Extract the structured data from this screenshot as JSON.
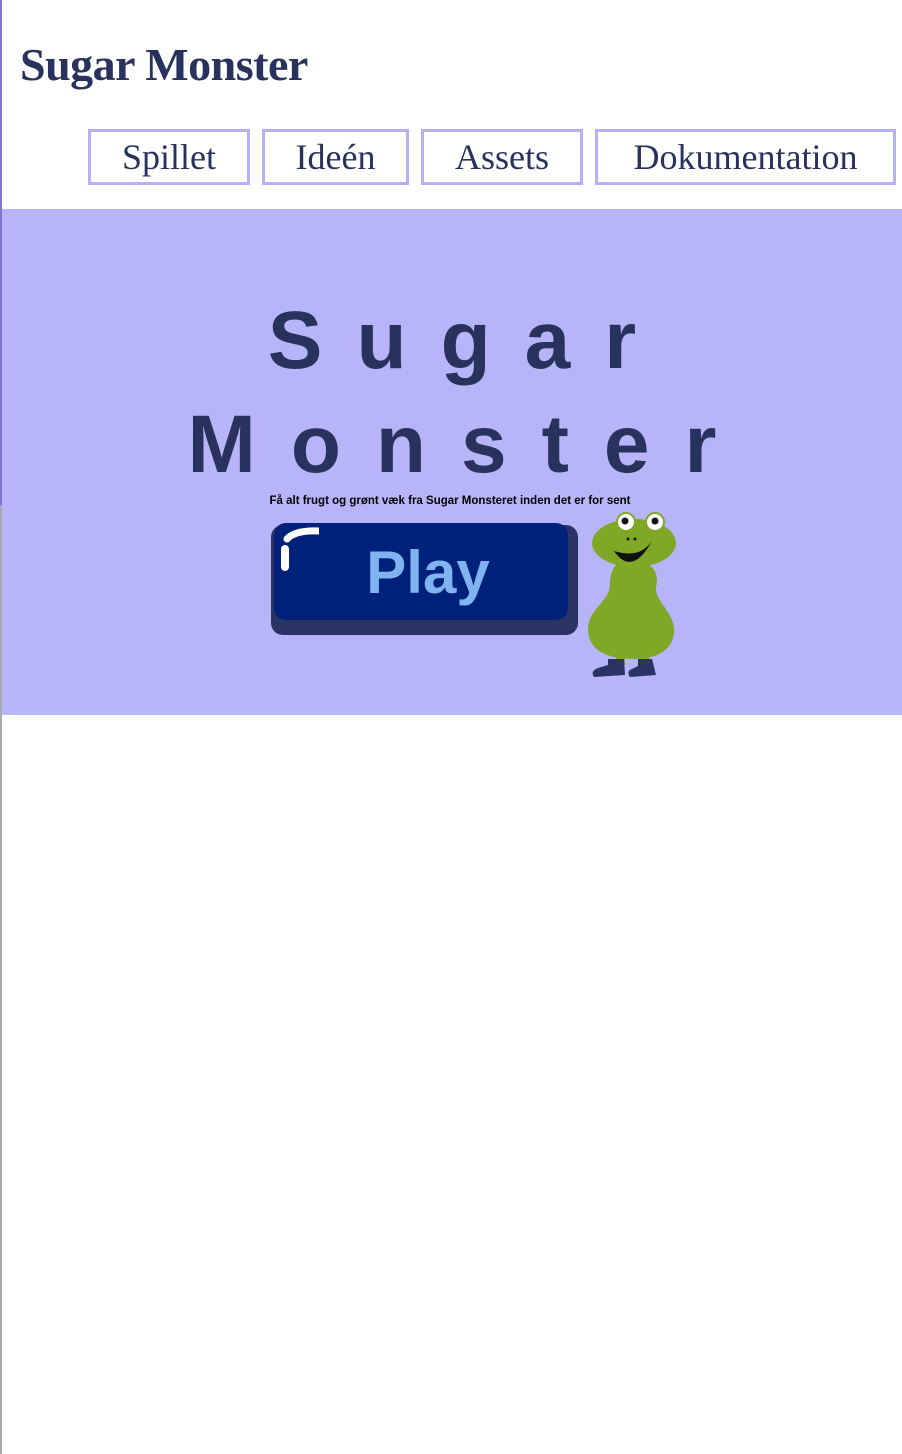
{
  "site": {
    "title": "Sugar Monster"
  },
  "nav": {
    "items": [
      {
        "label": "Spillet"
      },
      {
        "label": "Ideén"
      },
      {
        "label": "Assets"
      },
      {
        "label": "Dokumentation"
      }
    ]
  },
  "game": {
    "title_line1": "Sugar",
    "title_line2": "Monster",
    "tagline": "Få alt frugt og grønt væk fra Sugar Monsteret inden det er for sent",
    "play_label": "Play",
    "mascot_icon": "green-monster-icon"
  },
  "colors": {
    "title_text": "#29325c",
    "nav_border": "#b6b1f6",
    "game_background": "#b8b4f9",
    "play_button": "#00217a",
    "play_button_shadow": "#2b3364",
    "play_text": "#7fb4f0",
    "monster_body": "#7fa826",
    "monster_boots": "#2b3364"
  }
}
